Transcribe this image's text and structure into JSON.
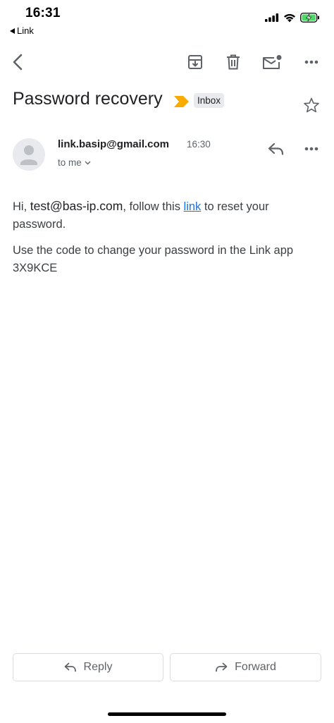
{
  "status_bar": {
    "time": "16:31",
    "back_app": "Link",
    "icons": [
      "signal-icon",
      "wifi-icon",
      "battery-charging-icon"
    ]
  },
  "toolbar": {
    "icons": [
      "back-arrow-icon",
      "archive-icon",
      "delete-icon",
      "mark-unread-icon",
      "more-icon"
    ]
  },
  "email": {
    "subject": "Password recovery",
    "label": "Inbox",
    "sender": "link.basip@gmail.com",
    "time": "16:30",
    "recipient": "to me",
    "body": {
      "greeting": "Hi,",
      "email_address": "test@bas-ip.com",
      "text_before_link": ", follow this",
      "link_text": "link",
      "text_after_link": "to reset your password.",
      "paragraph2": "Use the code to change your password in the Link app 3X9KCE"
    }
  },
  "actions": {
    "reply": "Reply",
    "forward": "Forward"
  },
  "colors": {
    "link": "#1a73e8",
    "important_marker": "#f9ab00",
    "badge_bg": "#e8eaed",
    "battery": "#4cd964"
  }
}
